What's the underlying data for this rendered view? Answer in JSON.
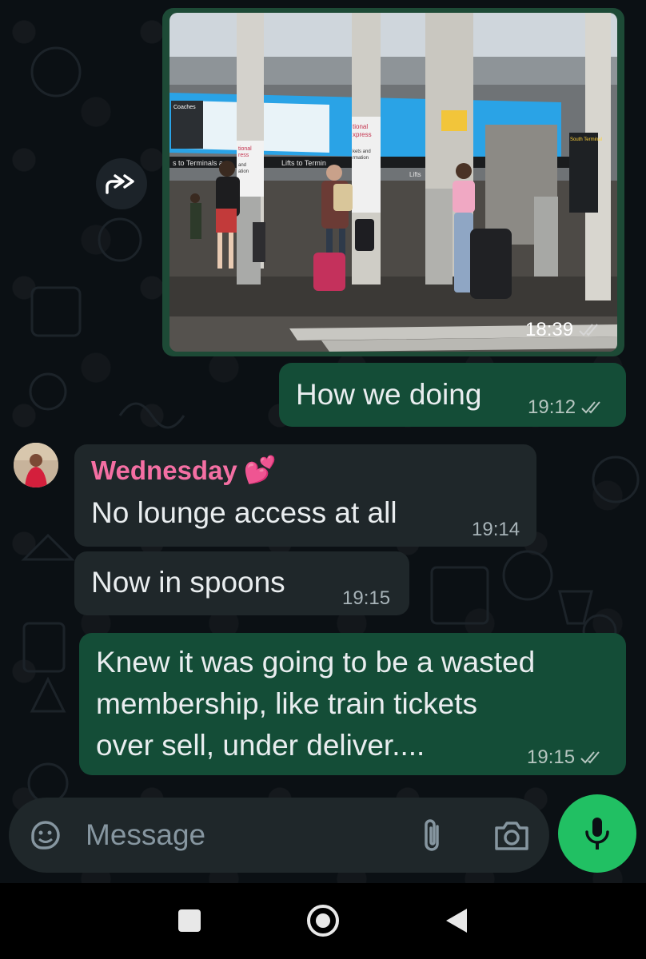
{
  "messages": [
    {
      "type": "image",
      "direction": "outgoing",
      "time": "18:39",
      "status": "read"
    },
    {
      "type": "text",
      "direction": "outgoing",
      "text": "How we doing",
      "time": "19:12",
      "status": "read"
    },
    {
      "type": "text",
      "direction": "incoming",
      "sender": "Wednesday",
      "sender_emoji": "💕",
      "text": "No lounge access at all",
      "time": "19:14"
    },
    {
      "type": "text",
      "direction": "incoming",
      "text": "Now in spoons",
      "time": "19:15"
    },
    {
      "type": "text",
      "direction": "outgoing",
      "lines": [
        "Knew it was going to be a wasted",
        "membership, like train tickets",
        "over sell, under deliver...."
      ],
      "time": "19:15",
      "status": "read"
    }
  ],
  "composer": {
    "placeholder": "Message"
  },
  "photo_signs": {
    "coaches": "Coaches",
    "terminals": "s to Terminals an",
    "lifts": "Lifts to Termin",
    "lifts2": "Lifts",
    "national": "tional",
    "express": "xpress",
    "info": "kets and",
    "info2": "rmation",
    "national_b": "tional",
    "express_b": "ress",
    "and": "and",
    "ation": "ation",
    "south": "South Terminal"
  },
  "icons": {
    "forward": "forward-icon",
    "read_receipt": "double-check-icon",
    "sticker": "sticker-icon",
    "attach": "paperclip-icon",
    "camera": "camera-icon",
    "mic": "microphone-icon"
  },
  "colors": {
    "outgoing_bubble": "#144d37",
    "incoming_bubble": "#1f272a",
    "sender_name": "#f46fa3",
    "mic_button": "#21c063"
  }
}
